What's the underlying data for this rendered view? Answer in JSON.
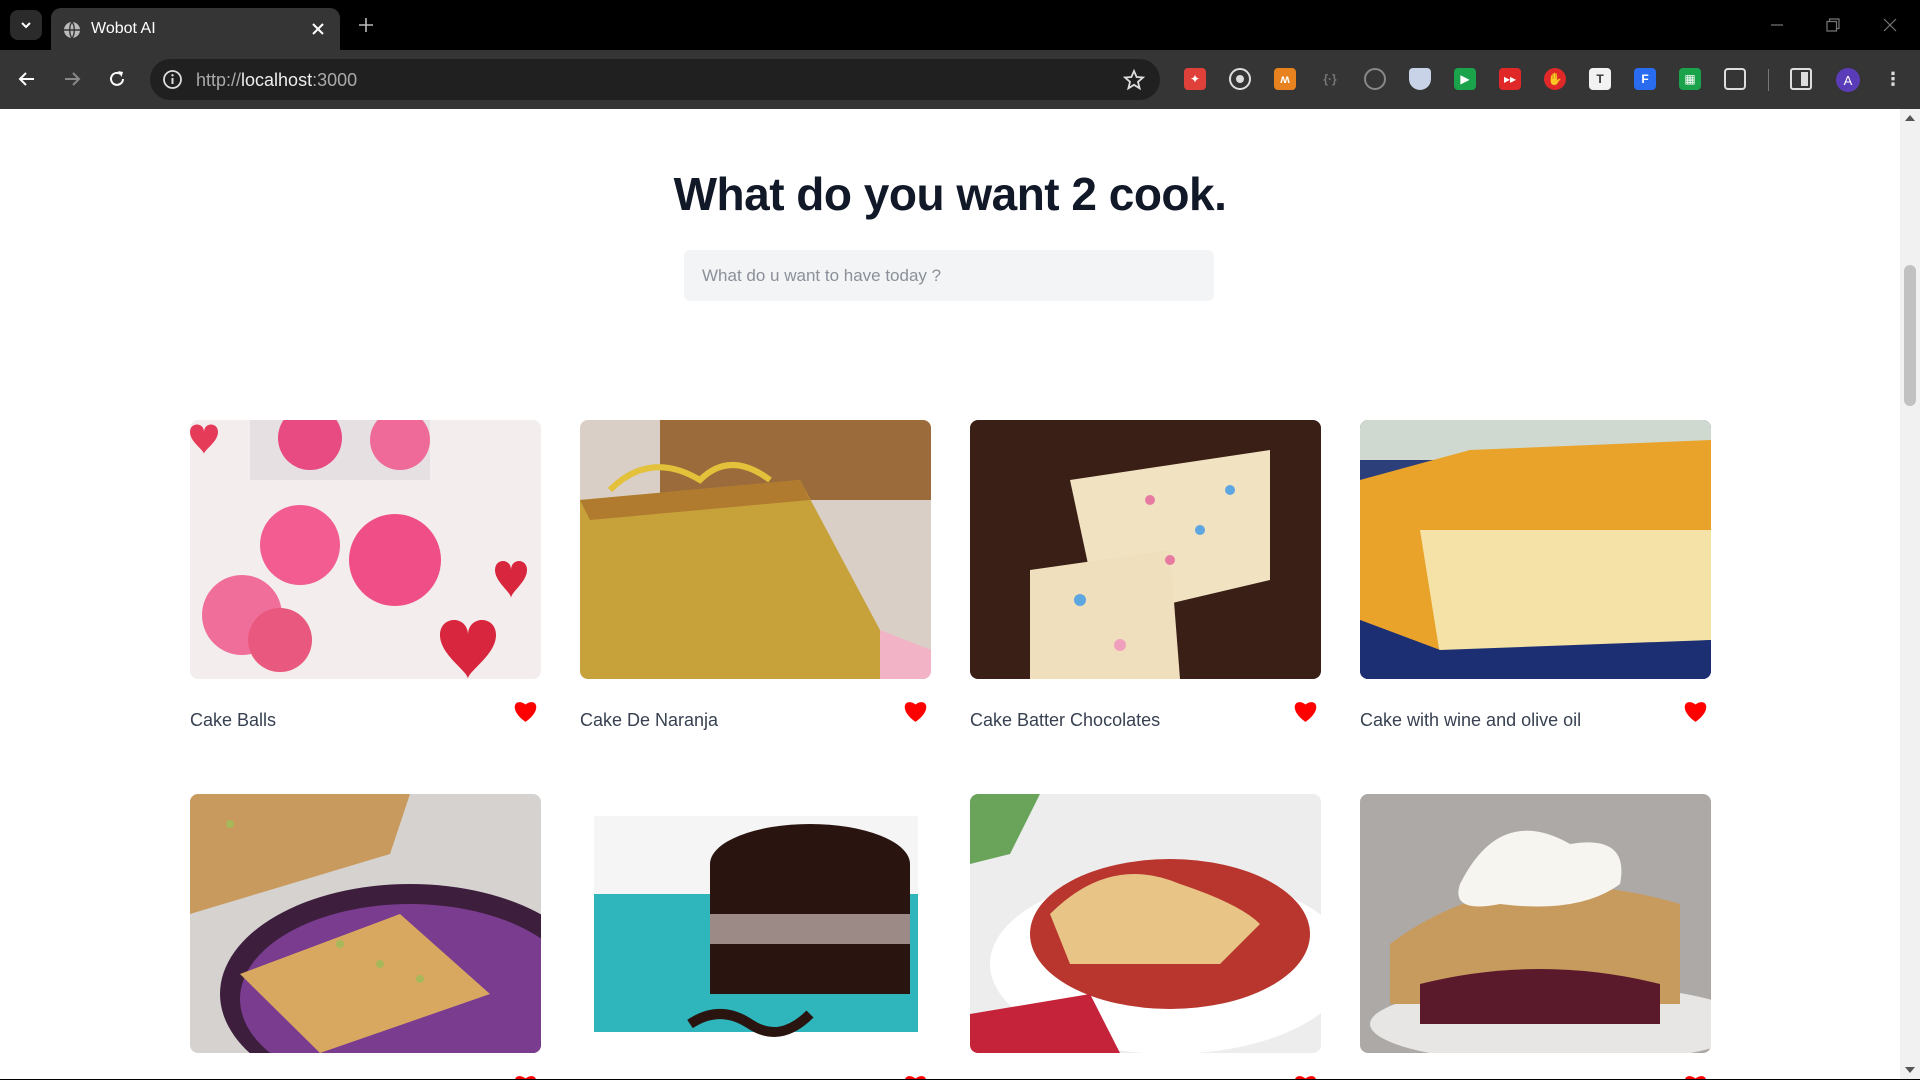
{
  "browser": {
    "tab_title": "Wobot AI",
    "url_scheme": "http://",
    "url_host": "localhost",
    "url_port": ":3000",
    "profile_initial": "A"
  },
  "page": {
    "heading": "What do you want 2 cook.",
    "search_placeholder": "What do u want to have today ?",
    "recipes": [
      {
        "name": "Cake Balls",
        "favorite": true
      },
      {
        "name": "Cake De Naranja",
        "favorite": true
      },
      {
        "name": "Cake Batter Chocolates",
        "favorite": true
      },
      {
        "name": "Cake with wine and olive oil",
        "favorite": true
      },
      {
        "name": "",
        "favorite": true
      },
      {
        "name": "",
        "favorite": true
      },
      {
        "name": "",
        "favorite": true
      },
      {
        "name": "",
        "favorite": true
      }
    ]
  },
  "colors": {
    "heading": "#111827",
    "heart": "#ff0000",
    "search_bg": "#f3f4f6"
  }
}
